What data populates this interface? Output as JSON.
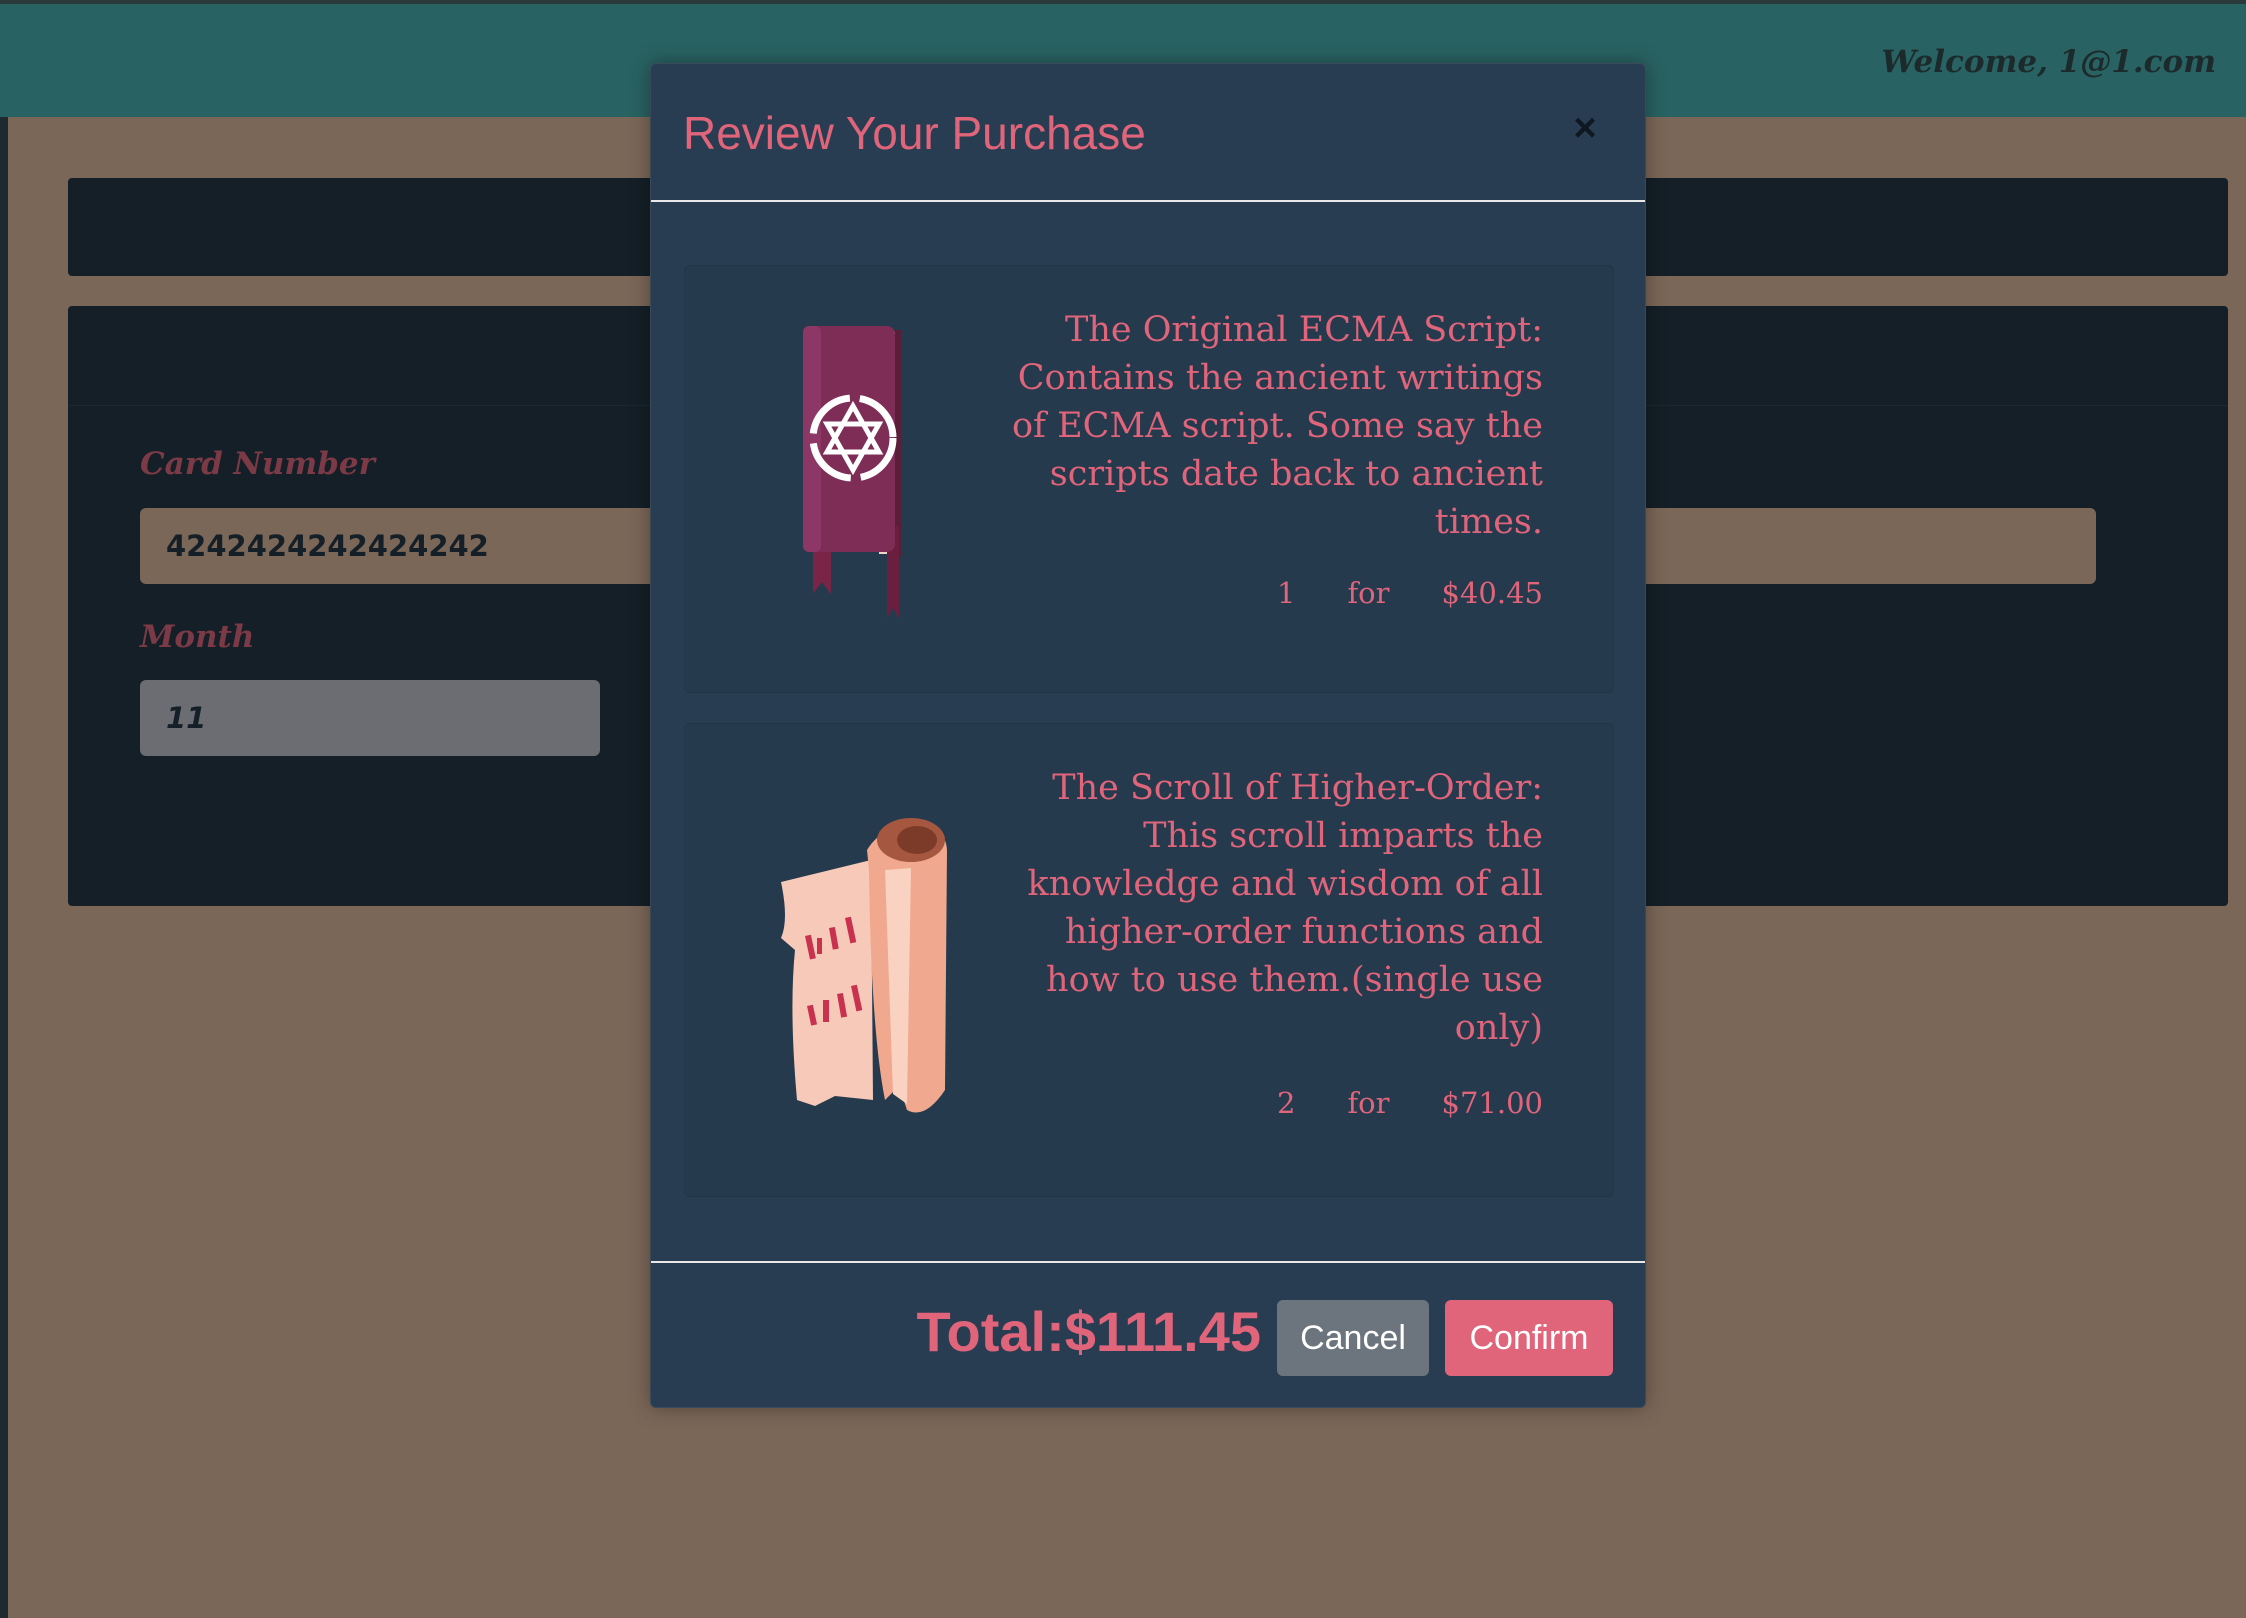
{
  "header": {
    "welcome": "Welcome, 1@1.com"
  },
  "form": {
    "card_label": "Card Number",
    "card_value": "4242424242424242",
    "month_label": "Month",
    "month_value": "11"
  },
  "modal": {
    "title": "Review Your Purchase",
    "close_icon": "close-icon",
    "items": [
      {
        "icon": "book-icon",
        "description": "The Original ECMA Script: Contains the ancient writings of ECMA script. Some say the scripts date back to ancient times.",
        "quantity": "1",
        "for_label": "for",
        "price": "$40.45"
      },
      {
        "icon": "scroll-icon",
        "description": "The Scroll of Higher-Order: This scroll imparts the knowledge and wisdom of all higher-order functions and how to use them.(single use only)",
        "quantity": "2",
        "for_label": "for",
        "price": "$71.00"
      }
    ],
    "total": "Total:$111.45",
    "cancel_label": "Cancel",
    "confirm_label": "Confirm"
  },
  "colors": {
    "accent": "#e0647a",
    "modal_bg": "#283d52",
    "topbar": "#296262",
    "page_bg": "#7b6758"
  }
}
